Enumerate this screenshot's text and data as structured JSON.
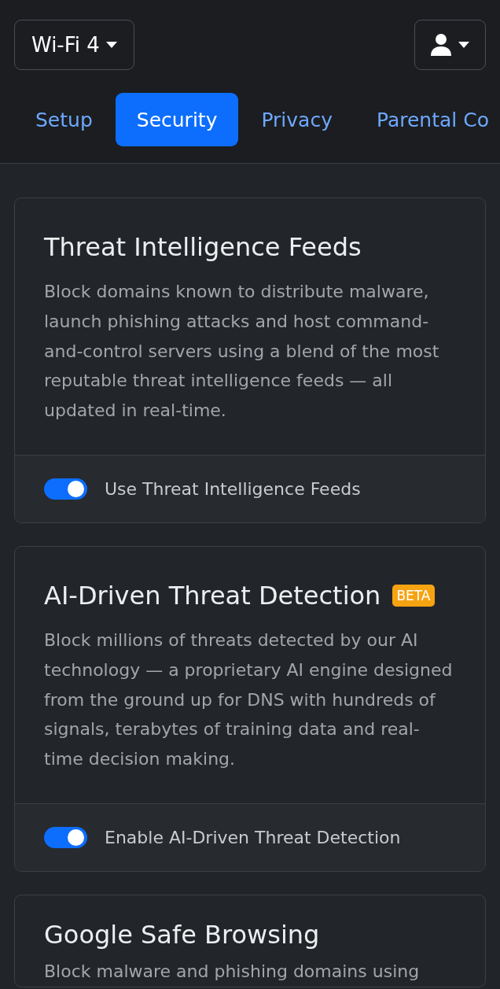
{
  "header": {
    "profile_selector": {
      "label": "Wi-Fi 4"
    }
  },
  "tabs": [
    {
      "label": "Setup",
      "selected": false
    },
    {
      "label": "Security",
      "selected": true
    },
    {
      "label": "Privacy",
      "selected": false
    },
    {
      "label": "Parental Co",
      "selected": false
    }
  ],
  "cards": [
    {
      "title": "Threat Intelligence Feeds",
      "description": "Block domains known to distribute malware, launch phishing attacks and host command-and-control servers using a blend of the most reputable threat intelligence feeds — all updated in real-time.",
      "toggle": {
        "label": "Use Threat Intelligence Feeds",
        "on": true
      }
    },
    {
      "title": "AI-Driven Threat Detection",
      "badge": "BETA",
      "description": "Block millions of threats detected by our AI technology — a proprietary AI engine designed from the ground up for DNS with hundreds of signals, terabytes of training data and real-time decision making.",
      "toggle": {
        "label": "Enable AI-Driven Threat Detection",
        "on": true
      }
    },
    {
      "title": "Google Safe Browsing",
      "description": "Block malware and phishing domains using"
    }
  ]
}
